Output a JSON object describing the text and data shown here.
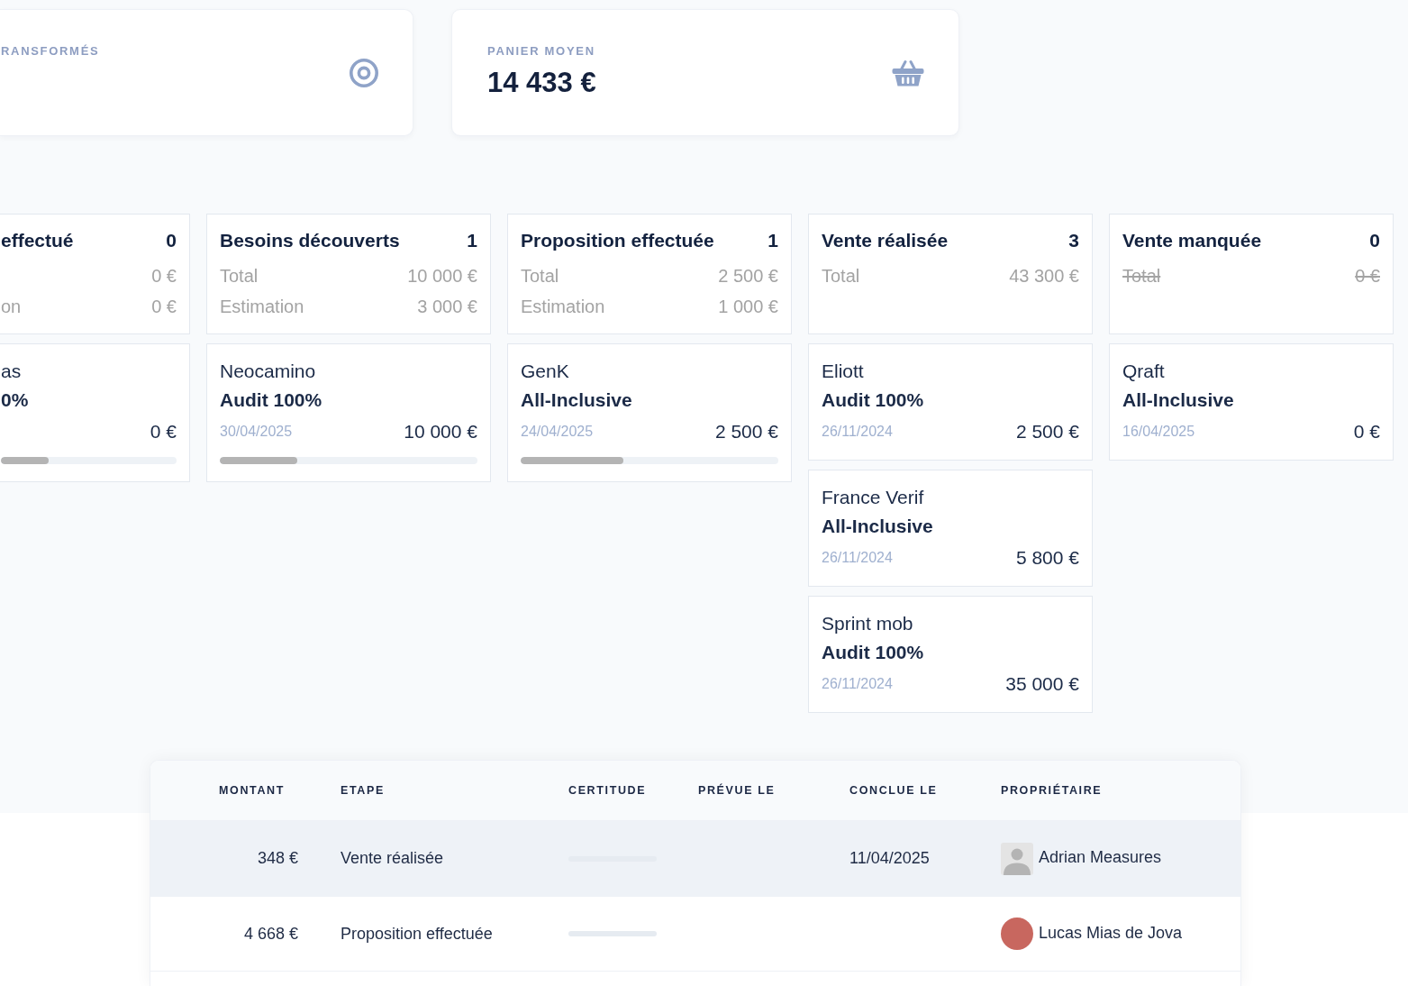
{
  "stat_cards": [
    {
      "label": "RANSFORMÉS"
    },
    {
      "label": "PANIER MOYEN",
      "value": "14 433 €"
    }
  ],
  "pipeline": [
    {
      "title": "effectué",
      "count": "0",
      "totals": [
        {
          "value": "0 €",
          "struck": false
        },
        {
          "label": "on",
          "value": "0 €",
          "struck": false
        }
      ],
      "cards": [
        {
          "name": "as",
          "product": "0%",
          "amount": "0 €",
          "progress": {
            "level": 0.27
          }
        }
      ]
    },
    {
      "title": "Besoins découverts",
      "count": "1",
      "totals": [
        {
          "label": "Total",
          "value": "10 000 €",
          "struck": false
        },
        {
          "label": "Estimation",
          "value": "3 000 €",
          "struck": false
        }
      ],
      "cards": [
        {
          "name": "Neocamino",
          "product": "Audit 100%",
          "date": "30/04/2025",
          "amount": "10 000 €",
          "progress": {
            "level": 0.3
          }
        }
      ]
    },
    {
      "title": "Proposition effectuée",
      "count": "1",
      "totals": [
        {
          "label": "Total",
          "value": "2 500 €",
          "struck": false
        },
        {
          "label": "Estimation",
          "value": "1 000 €",
          "struck": false
        }
      ],
      "cards": [
        {
          "name": "GenK",
          "product": "All-Inclusive",
          "date": "24/04/2025",
          "amount": "2 500 €",
          "progress": {
            "level": 0.4
          }
        }
      ]
    },
    {
      "title": "Vente réalisée",
      "count": "3",
      "totals": [
        {
          "label": "Total",
          "value": "43 300 €",
          "struck": false
        }
      ],
      "cards": [
        {
          "name": "Eliott",
          "product": "Audit 100%",
          "date": "26/11/2024",
          "amount": "2 500 €"
        },
        {
          "name": "France Verif",
          "product": "All-Inclusive",
          "date": "26/11/2024",
          "amount": "5 800 €"
        },
        {
          "name": "Sprint mob",
          "product": "Audit 100%",
          "date": "26/11/2024",
          "amount": "35 000 €"
        }
      ]
    },
    {
      "title": "Vente manquée",
      "count": "0",
      "totals": [
        {
          "label": "Total",
          "value": "0 €",
          "struck": true
        }
      ],
      "cards": [
        {
          "name": "Qraft",
          "product": "All-Inclusive",
          "date": "16/04/2025",
          "amount": "0 €"
        }
      ]
    }
  ],
  "table": {
    "columns": [
      "MONTANT",
      "ETAPE",
      "CERTITUDE",
      "PRÉVUE LE",
      "CONCLUE LE",
      "PROPRIÉTAIRE"
    ],
    "rows": [
      {
        "amount": "348 €",
        "stage": "Vente réalisée",
        "certitude": {
          "level": 0
        },
        "closed_on": "11/04/2025",
        "owner": {
          "kind": "silhouette",
          "name": "Adrian Measures"
        },
        "highlighted": true
      },
      {
        "amount": "4 668 €",
        "stage": "Proposition effectuée",
        "certitude": {
          "level": 0
        },
        "owner": {
          "kind": "photo",
          "name": "Lucas Mias de Jova"
        },
        "highlighted": false
      }
    ]
  }
}
